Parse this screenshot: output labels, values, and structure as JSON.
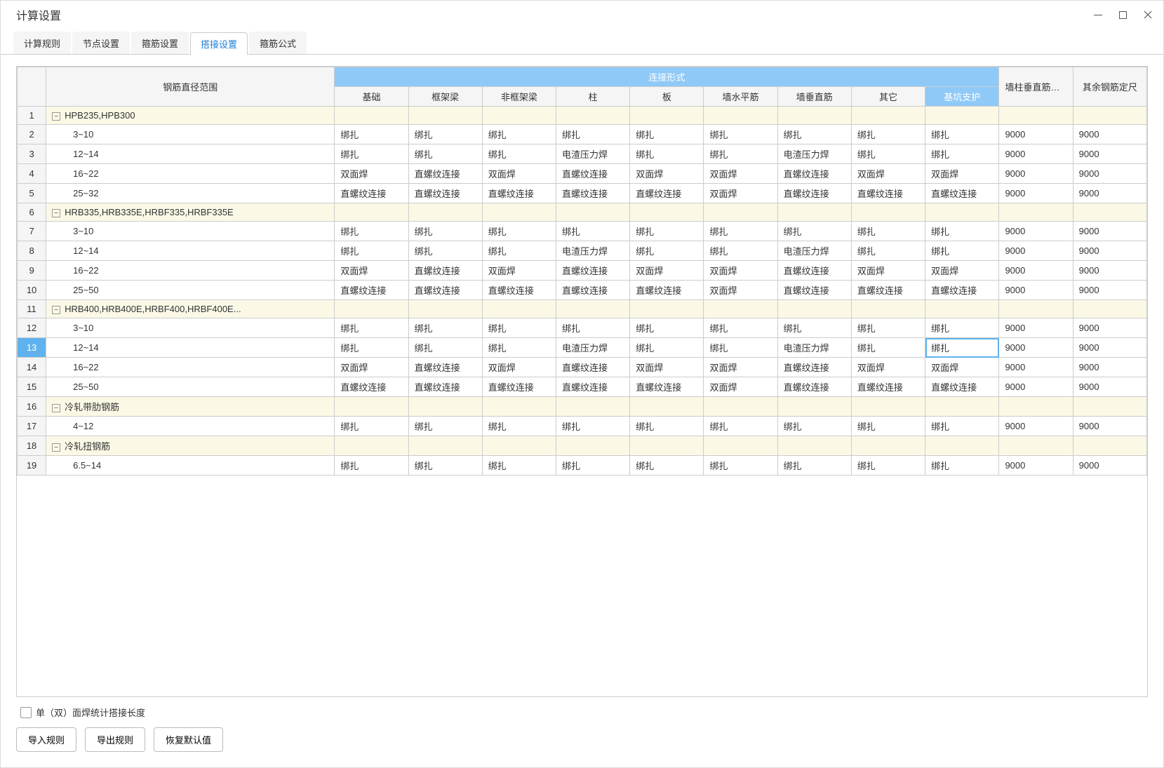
{
  "title": "计算设置",
  "tabs": [
    "计算规则",
    "节点设置",
    "搭接设置",
    "搭接设置",
    "箍筋公式"
  ],
  "tabs_real": {
    "t0": "计算规则",
    "t1": "节点设置",
    "t2": "箍筋设置",
    "t3": "搭接设置",
    "t4": "箍筋公式"
  },
  "active_tab_index": 3,
  "header": {
    "range": "钢筋直径范围",
    "conn": "连接形式",
    "c0": "基础",
    "c1": "框架梁",
    "c2": "非框架梁",
    "c3": "柱",
    "c4": "板",
    "c5": "墙水平筋",
    "c6": "墙垂直筋",
    "c7": "其它",
    "c8": "基坑支护",
    "tail1": "墙柱垂直筋定尺",
    "tail2": "其余钢筋定尺"
  },
  "rows": [
    {
      "n": "1",
      "type": "group",
      "label": "HPB235,HPB300"
    },
    {
      "n": "2",
      "type": "child",
      "label": "3~10",
      "v": [
        "绑扎",
        "绑扎",
        "绑扎",
        "绑扎",
        "绑扎",
        "绑扎",
        "绑扎",
        "绑扎",
        "绑扎",
        "9000",
        "9000"
      ]
    },
    {
      "n": "3",
      "type": "child",
      "label": "12~14",
      "v": [
        "绑扎",
        "绑扎",
        "绑扎",
        "电渣压力焊",
        "绑扎",
        "绑扎",
        "电渣压力焊",
        "绑扎",
        "绑扎",
        "9000",
        "9000"
      ]
    },
    {
      "n": "4",
      "type": "child",
      "label": "16~22",
      "v": [
        "双面焊",
        "直螺纹连接",
        "双面焊",
        "直螺纹连接",
        "双面焊",
        "双面焊",
        "直螺纹连接",
        "双面焊",
        "双面焊",
        "9000",
        "9000"
      ]
    },
    {
      "n": "5",
      "type": "child",
      "label": "25~32",
      "v": [
        "直螺纹连接",
        "直螺纹连接",
        "直螺纹连接",
        "直螺纹连接",
        "直螺纹连接",
        "双面焊",
        "直螺纹连接",
        "直螺纹连接",
        "直螺纹连接",
        "9000",
        "9000"
      ]
    },
    {
      "n": "6",
      "type": "group",
      "label": "HRB335,HRB335E,HRBF335,HRBF335E"
    },
    {
      "n": "7",
      "type": "child",
      "label": "3~10",
      "v": [
        "绑扎",
        "绑扎",
        "绑扎",
        "绑扎",
        "绑扎",
        "绑扎",
        "绑扎",
        "绑扎",
        "绑扎",
        "9000",
        "9000"
      ]
    },
    {
      "n": "8",
      "type": "child",
      "label": "12~14",
      "v": [
        "绑扎",
        "绑扎",
        "绑扎",
        "电渣压力焊",
        "绑扎",
        "绑扎",
        "电渣压力焊",
        "绑扎",
        "绑扎",
        "9000",
        "9000"
      ]
    },
    {
      "n": "9",
      "type": "child",
      "label": "16~22",
      "v": [
        "双面焊",
        "直螺纹连接",
        "双面焊",
        "直螺纹连接",
        "双面焊",
        "双面焊",
        "直螺纹连接",
        "双面焊",
        "双面焊",
        "9000",
        "9000"
      ]
    },
    {
      "n": "10",
      "type": "child",
      "label": "25~50",
      "v": [
        "直螺纹连接",
        "直螺纹连接",
        "直螺纹连接",
        "直螺纹连接",
        "直螺纹连接",
        "双面焊",
        "直螺纹连接",
        "直螺纹连接",
        "直螺纹连接",
        "9000",
        "9000"
      ]
    },
    {
      "n": "11",
      "type": "group",
      "label": "HRB400,HRB400E,HRBF400,HRBF400E..."
    },
    {
      "n": "12",
      "type": "child",
      "label": "3~10",
      "v": [
        "绑扎",
        "绑扎",
        "绑扎",
        "绑扎",
        "绑扎",
        "绑扎",
        "绑扎",
        "绑扎",
        "绑扎",
        "9000",
        "9000"
      ]
    },
    {
      "n": "13",
      "type": "child",
      "label": "12~14",
      "v": [
        "绑扎",
        "绑扎",
        "绑扎",
        "电渣压力焊",
        "绑扎",
        "绑扎",
        "电渣压力焊",
        "绑扎",
        "绑扎",
        "9000",
        "9000"
      ],
      "selected_row": true,
      "selected_cell": 8
    },
    {
      "n": "14",
      "type": "child",
      "label": "16~22",
      "v": [
        "双面焊",
        "直螺纹连接",
        "双面焊",
        "直螺纹连接",
        "双面焊",
        "双面焊",
        "直螺纹连接",
        "双面焊",
        "双面焊",
        "9000",
        "9000"
      ]
    },
    {
      "n": "15",
      "type": "child",
      "label": "25~50",
      "v": [
        "直螺纹连接",
        "直螺纹连接",
        "直螺纹连接",
        "直螺纹连接",
        "直螺纹连接",
        "双面焊",
        "直螺纹连接",
        "直螺纹连接",
        "直螺纹连接",
        "9000",
        "9000"
      ]
    },
    {
      "n": "16",
      "type": "group",
      "label": "冷轧带肋钢筋"
    },
    {
      "n": "17",
      "type": "child",
      "label": "4~12",
      "v": [
        "绑扎",
        "绑扎",
        "绑扎",
        "绑扎",
        "绑扎",
        "绑扎",
        "绑扎",
        "绑扎",
        "绑扎",
        "9000",
        "9000"
      ]
    },
    {
      "n": "18",
      "type": "group",
      "label": "冷轧扭钢筋"
    },
    {
      "n": "19",
      "type": "child",
      "label": "6.5~14",
      "v": [
        "绑扎",
        "绑扎",
        "绑扎",
        "绑扎",
        "绑扎",
        "绑扎",
        "绑扎",
        "绑扎",
        "绑扎",
        "9000",
        "9000"
      ]
    }
  ],
  "checkbox_label": "单（双）面焊统计搭接长度",
  "buttons": {
    "import": "导入规则",
    "export": "导出规则",
    "reset": "恢复默认值"
  }
}
